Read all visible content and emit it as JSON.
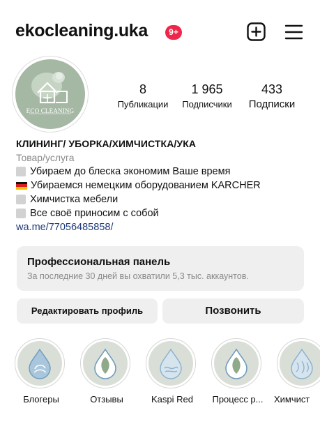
{
  "header": {
    "username": "ekocleaning.uka",
    "notifications_badge": "9+"
  },
  "profile": {
    "avatar_text": "ECO CLEANING"
  },
  "stats": {
    "posts": {
      "value": "8",
      "label": "Публикации"
    },
    "followers": {
      "value": "1 965",
      "label": "Подписчики"
    },
    "following": {
      "value": "433",
      "label": "Подписки"
    }
  },
  "bio": {
    "name": "КЛИНИНГ/ УБОРКА/ХИМЧИСТКА/УКА",
    "category": "Товар/услуга",
    "lines": [
      "Убираем до блеска экономим Ваше время",
      "Убираемся немецким оборудованием KARCHER",
      "Химчистка мебели",
      "Все своё приносим с собой"
    ],
    "link": "wa.me/77056485858/"
  },
  "pro_panel": {
    "title": "Профессиональная панель",
    "subtitle": "За последние 30 дней вы охватили 5,3 тыс. аккаунтов."
  },
  "buttons": {
    "edit_profile": "Редактировать профиль",
    "call": "Позвонить"
  },
  "highlights": [
    {
      "label": "Блогеры",
      "icon": "water-drop-icon"
    },
    {
      "label": "Отзывы",
      "icon": "leaf-drop-icon"
    },
    {
      "label": "Kaspi Red",
      "icon": "water-drop-icon"
    },
    {
      "label": "Процесс р...",
      "icon": "leaf-drop-icon"
    },
    {
      "label": "Химчист",
      "icon": "water-drop-icon"
    }
  ],
  "colors": {
    "badge": "#f0254a",
    "link": "#1f3a7a",
    "panel_bg": "#efefef",
    "avatar_bg": "#a5b8a4",
    "highlight_bg": "#d9dfd6"
  }
}
